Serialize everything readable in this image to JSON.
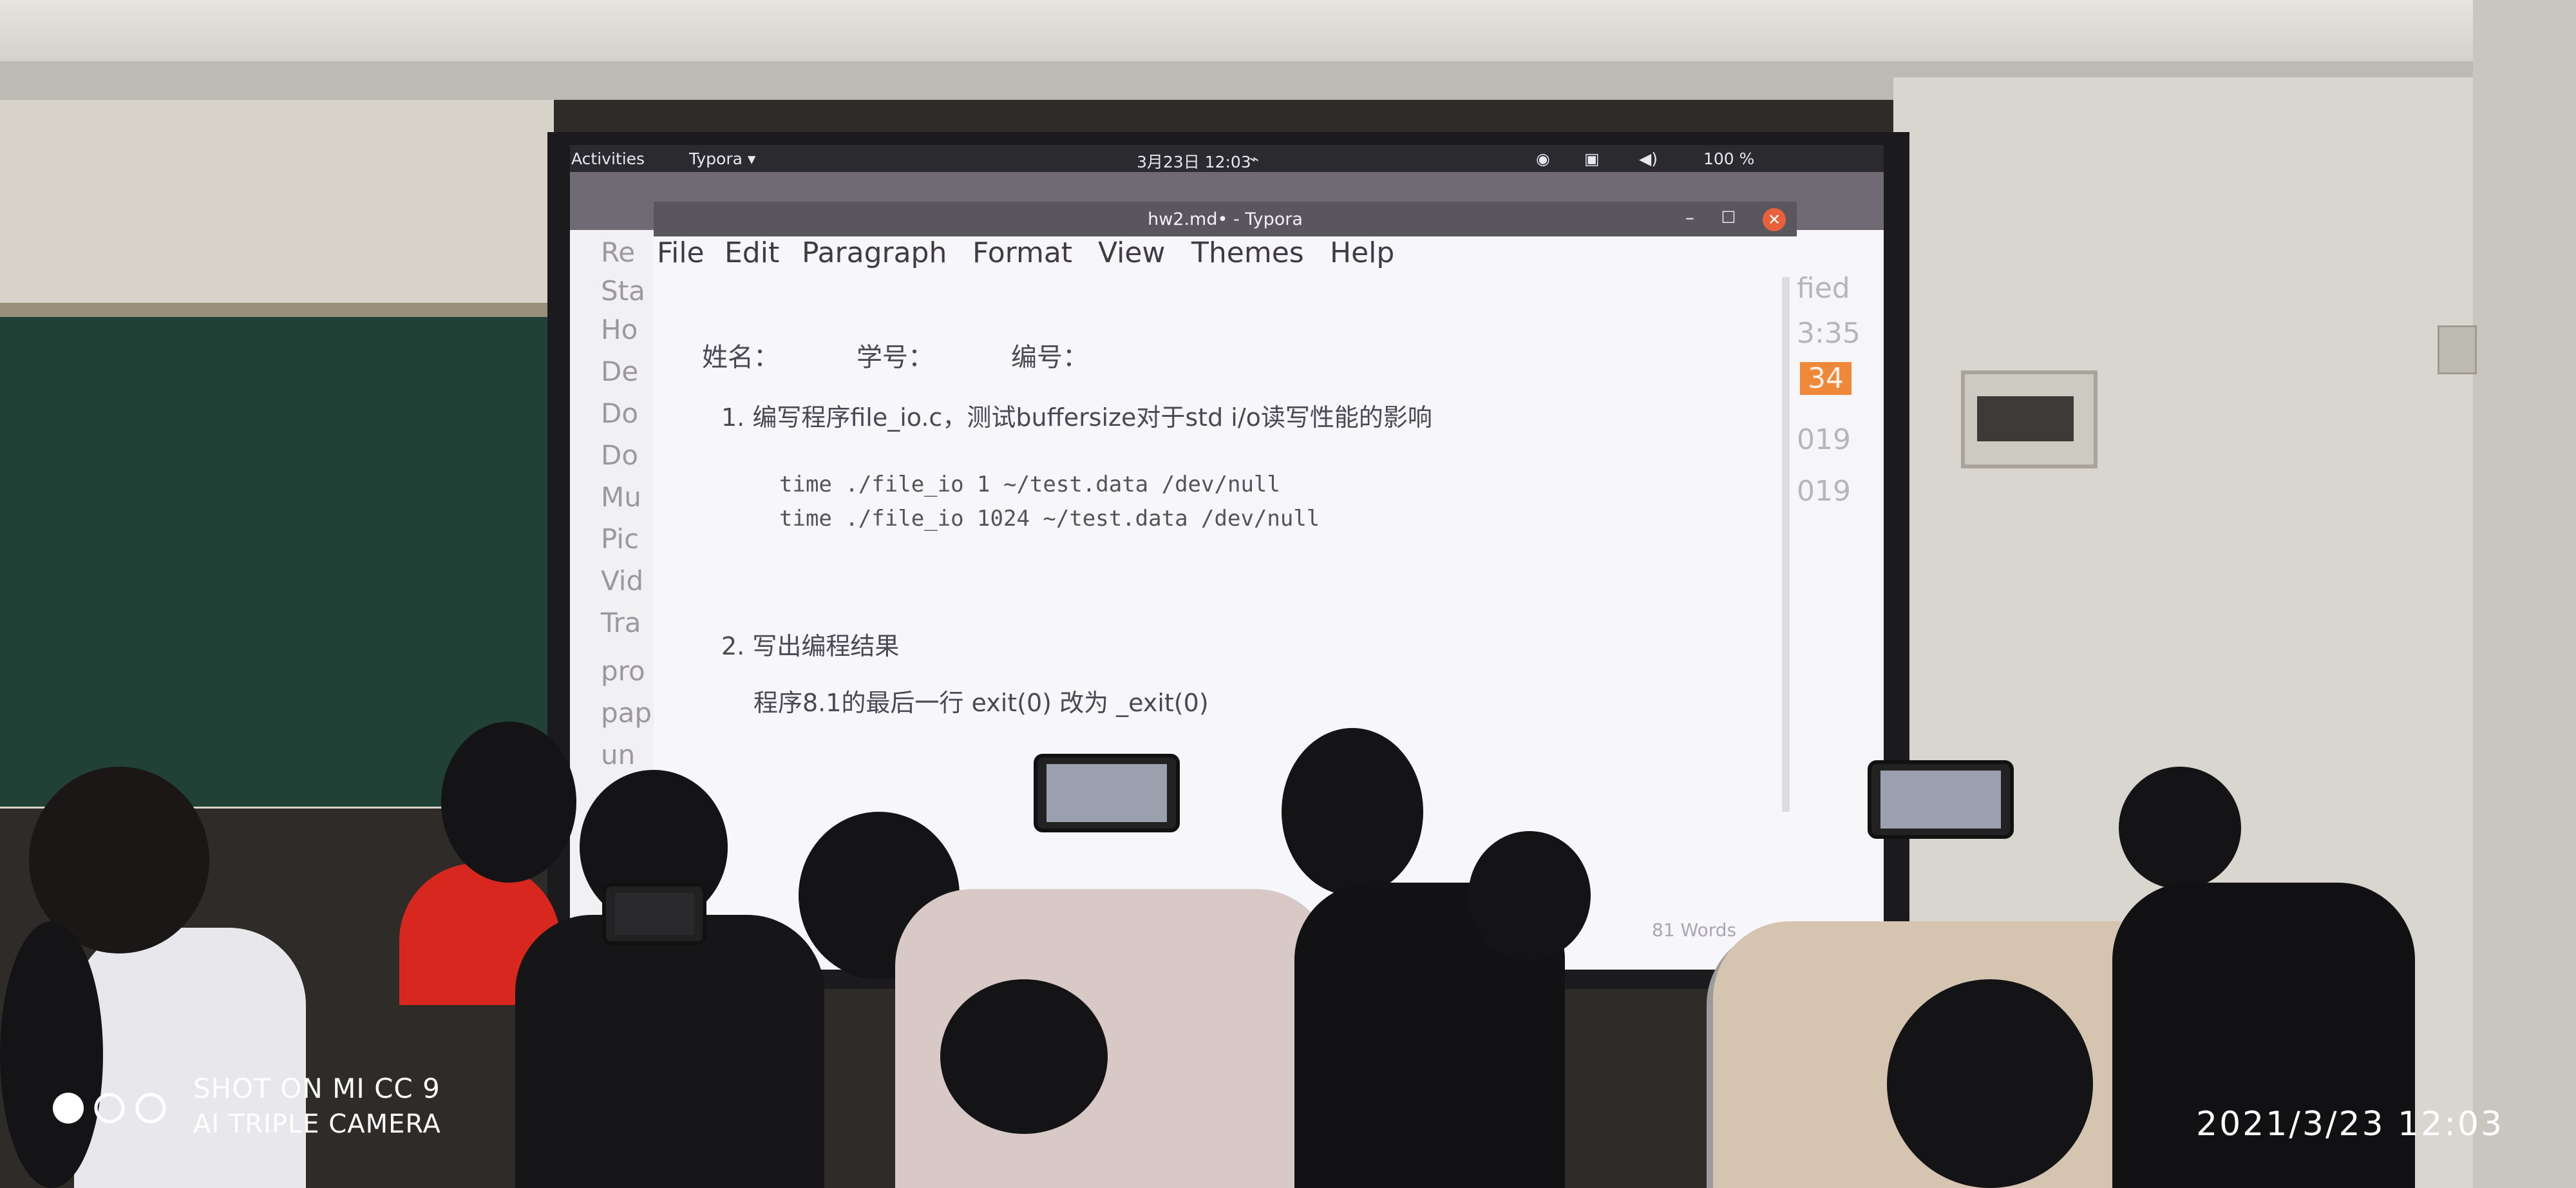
{
  "topbar": {
    "activities": "Activities",
    "app_menu": "Typora ▾",
    "clock": "3月23日 12:03",
    "battery": "100 %"
  },
  "file_manager": {
    "sidebar_items": [
      "Re",
      "Sta",
      "Ho",
      "De",
      "Do",
      "Do",
      "Mu",
      "Pic",
      "Vid",
      "Tra",
      "pro",
      "pap",
      "un"
    ],
    "right_column": [
      "fied",
      "3:35",
      "34",
      "019",
      "019"
    ]
  },
  "typora": {
    "title": "hw2.md• - Typora",
    "menu": [
      "File",
      "Edit",
      "Paragraph",
      "Format",
      "View",
      "Themes",
      "Help"
    ],
    "doc": {
      "name_label": "姓名：",
      "id_label": "学号：",
      "no_label": "编号：",
      "item1": "1. 编写程序file_io.c，测试buffersize对于std i/o读写性能的影响",
      "code_line1": "time ./file_io    1   ~/test.data  /dev/null",
      "code_line2": "time ./file_io 1024   ~/test.data   /dev/null",
      "item2": "2. 写出编程结果",
      "item2_text": "程序8.1的最后一行 exit(0) 改为 _exit(0)",
      "word_count": "81 Words"
    }
  },
  "watermark": {
    "line1": "SHOT ON MI CC 9",
    "line2": "AI TRIPLE CAMERA",
    "datetime": "2021/3/23 12:03"
  },
  "colors": {
    "close_button": "#e9613a",
    "highlight": "#f0883a",
    "topbar": "#2b2a2f"
  }
}
